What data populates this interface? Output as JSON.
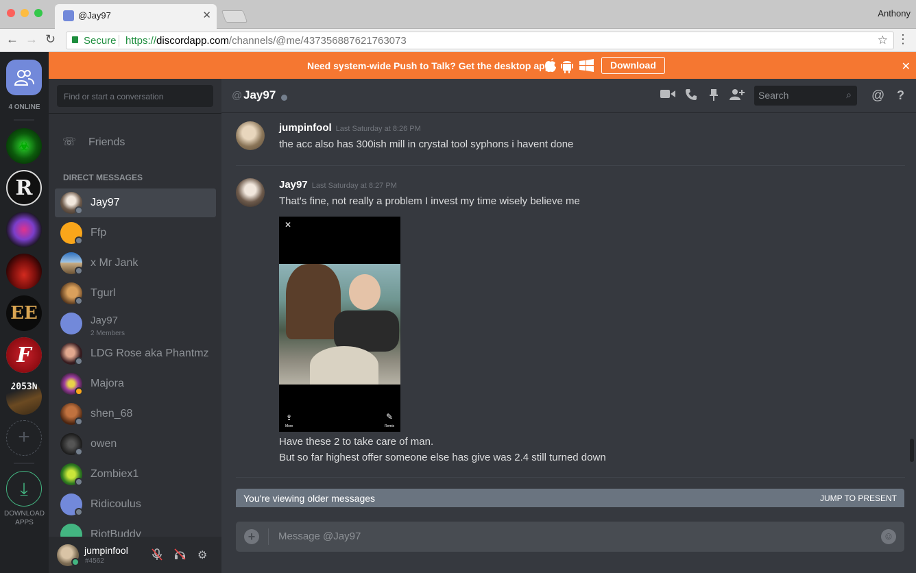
{
  "browser": {
    "tab_title": "@Jay97",
    "profile_name": "Anthony",
    "secure_label": "Secure",
    "url_protocol": "https://",
    "url_host": "discordapp.com",
    "url_path": "/channels/@me/437356887621763073"
  },
  "guilds": {
    "online_label": "4 ONLINE",
    "download_label_1": "DOWNLOAD",
    "download_label_2": "APPS",
    "server_text_2053": "2053N",
    "server_text_ee": "EE",
    "server_text_f": "F",
    "server_text_r": "R"
  },
  "banner": {
    "text": "Need system-wide Push to Talk? Get the desktop app!",
    "button": "Download"
  },
  "channels": {
    "search_placeholder": "Find or start a conversation",
    "friends_label": "Friends",
    "dm_header": "DIRECT MESSAGES",
    "dms": [
      {
        "name": "Jay97"
      },
      {
        "name": "Ffp"
      },
      {
        "name": "x Mr Jank"
      },
      {
        "name": "Tgurl"
      },
      {
        "name": "Jay97",
        "sub": "2 Members"
      },
      {
        "name": "LDG Rose aka Phantmz"
      },
      {
        "name": "Majora"
      },
      {
        "name": "shen_68"
      },
      {
        "name": "owen"
      },
      {
        "name": "Zombiex1"
      },
      {
        "name": "Ridicoulus"
      },
      {
        "name": "RiotBuddy"
      }
    ]
  },
  "user": {
    "name": "jumpinfool",
    "tag": "#4562"
  },
  "header": {
    "title": "Jay97",
    "search_placeholder": "Search"
  },
  "messages": [
    {
      "author": "jumpinfool",
      "timestamp": "Last Saturday at 8:26 PM",
      "lines": [
        "the acc also has 300ish mill in crystal tool syphons i havent done"
      ]
    },
    {
      "author": "Jay97",
      "timestamp": "Last Saturday at 8:27 PM",
      "lines": [
        "That's fine, not really a problem I invest my time wisely believe me",
        "Have these 2 to take care of man.",
        "But so far highest offer someone else has give was 2.4 still turned down"
      ],
      "attachment": {
        "more_label": "More",
        "remix_label": "Remix"
      }
    }
  ],
  "older_bar": {
    "text": "You're viewing older messages",
    "jump": "JUMP TO PRESENT"
  },
  "composer": {
    "placeholder": "Message @Jay97"
  },
  "colors": {
    "blurple": "#7289da",
    "banner": "#f57731",
    "online": "#43b581",
    "offline": "#747f8d",
    "idle": "#faa61a"
  }
}
